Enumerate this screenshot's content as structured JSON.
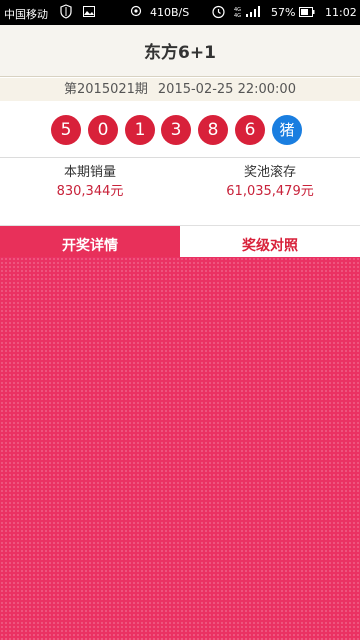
{
  "status_bar": {
    "carrier": "中国移动",
    "speed": "410B/S",
    "battery_percent": "57%",
    "time": "11:02",
    "icons": [
      "shield-icon",
      "image-icon",
      "gps-icon",
      "alarm-icon",
      "network-signal-icon",
      "battery-icon"
    ]
  },
  "header": {
    "title": "东方6+1"
  },
  "draw": {
    "issue": "第2015021期",
    "datetime": "2015-02-25 22:00:00",
    "numbers": [
      "5",
      "0",
      "1",
      "3",
      "8",
      "6"
    ],
    "zodiac": "猪"
  },
  "stats": {
    "sales_label": "本期销量",
    "sales_value": "830,344元",
    "pool_label": "奖池滚存",
    "pool_value": "61,035,479元"
  },
  "tabs": [
    {
      "label": "开奖详情",
      "active": true
    },
    {
      "label": "奖级对照",
      "active": false
    }
  ],
  "colors": {
    "accent": "#e8305a",
    "ball_red": "#d8213a",
    "ball_blue": "#1a7ee0",
    "header_bg": "#f6f4ef"
  }
}
